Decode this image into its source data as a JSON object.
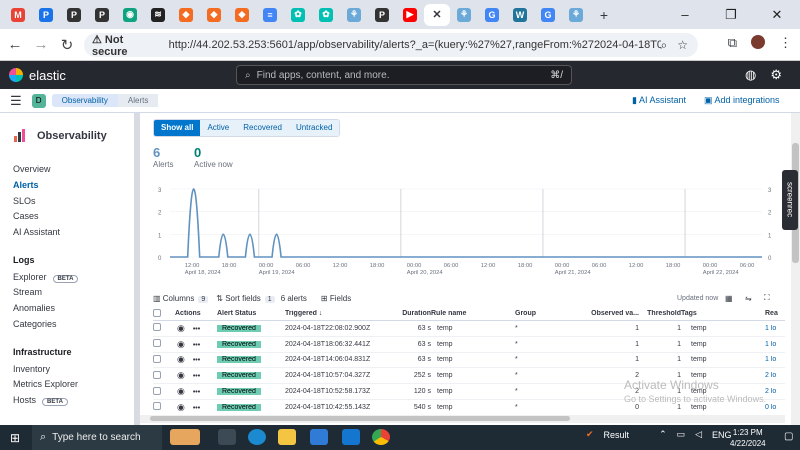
{
  "browser": {
    "window_controls": [
      "–",
      "❐",
      "✕"
    ],
    "back": "←",
    "forward": "→",
    "reload": "↻",
    "security_label": "Not secure",
    "url": "http://44.202.53.253:5601/app/observability/alerts?_a=(kuery:%27%27,rangeFrom:%272024-04-18T07:29:13.770Z...",
    "tabs": [
      {
        "letter": "M",
        "color": "#ea4335"
      },
      {
        "letter": "P",
        "color": "#1a73e8"
      },
      {
        "letter": "P",
        "color": "#333333"
      },
      {
        "letter": "P",
        "color": "#333333"
      },
      {
        "letter": "◉",
        "color": "#10a37f"
      },
      {
        "letter": "≋",
        "color": "#222222"
      },
      {
        "letter": "◆",
        "color": "#f36c21"
      },
      {
        "letter": "◆",
        "color": "#f36c21"
      },
      {
        "letter": "◆",
        "color": "#f36c21"
      },
      {
        "letter": "≡",
        "color": "#4285f4"
      },
      {
        "letter": "✿",
        "color": "#00bfb3"
      },
      {
        "letter": "✿",
        "color": "#00bfb3"
      },
      {
        "letter": "⚘",
        "color": "#6aa9d8"
      },
      {
        "letter": "P",
        "color": "#333333"
      },
      {
        "letter": "▶",
        "color": "#ff0000"
      }
    ],
    "tabs_after": [
      {
        "letter": "⚘",
        "color": "#6aa9d8"
      },
      {
        "letter": "G",
        "color": "#4285f4"
      },
      {
        "letter": "W",
        "color": "#21759b"
      },
      {
        "letter": "G",
        "color": "#4285f4"
      },
      {
        "letter": "⚘",
        "color": "#6aa9d8"
      }
    ],
    "new_tab": "+"
  },
  "elastic": {
    "brand": "elastic",
    "search_placeholder": "Find apps, content, and more.",
    "kbd": "⌘/"
  },
  "breadcrumb": {
    "space": "D",
    "items": [
      "Observability",
      "Alerts"
    ],
    "ai_assistant": "AI Assistant",
    "add_integrations": "Add integrations"
  },
  "sidebar": {
    "title": "Observability",
    "items": [
      "Overview",
      "Alerts",
      "SLOs",
      "Cases",
      "AI Assistant"
    ],
    "logs_title": "Logs",
    "logs": [
      "Explorer",
      "Stream",
      "Anomalies",
      "Categories"
    ],
    "infra_title": "Infrastructure",
    "infra": [
      "Inventory",
      "Metrics Explorer",
      "Hosts"
    ],
    "beta": "BETA"
  },
  "filters": [
    "Show all",
    "Active",
    "Recovered",
    "Untracked"
  ],
  "stats": {
    "alerts_value": "6",
    "alerts_label": "Alerts",
    "active_value": "0",
    "active_label": "Active now"
  },
  "chart_data": {
    "type": "area",
    "y_ticks_left": [
      "3",
      "2",
      "1",
      "0"
    ],
    "y_ticks_right": [
      "3",
      "2",
      "1",
      "0"
    ],
    "x_ticks": [
      {
        "t": "12:00",
        "d": "April 18, 2024"
      },
      {
        "t": "18:00",
        "d": ""
      },
      {
        "t": "00:00",
        "d": "April 19, 2024"
      },
      {
        "t": "06:00",
        "d": ""
      },
      {
        "t": "12:00",
        "d": ""
      },
      {
        "t": "18:00",
        "d": ""
      },
      {
        "t": "00:00",
        "d": "April 20, 2024"
      },
      {
        "t": "06:00",
        "d": ""
      },
      {
        "t": "12:00",
        "d": ""
      },
      {
        "t": "18:00",
        "d": ""
      },
      {
        "t": "00:00",
        "d": "April 21, 2024"
      },
      {
        "t": "06:00",
        "d": ""
      },
      {
        "t": "12:00",
        "d": ""
      },
      {
        "t": "18:00",
        "d": ""
      },
      {
        "t": "00:00",
        "d": "April 22, 2024"
      },
      {
        "t": "06:00",
        "d": ""
      }
    ],
    "ylim": [
      0,
      3
    ],
    "peaks": [
      {
        "x": 0.04,
        "y": 3
      },
      {
        "x": 0.09,
        "y": 1
      },
      {
        "x": 0.135,
        "y": 1
      },
      {
        "x": 0.18,
        "y": 1
      }
    ],
    "color": "#6092c0"
  },
  "toolbar": {
    "columns": "Columns",
    "columns_count": "9",
    "sort": "Sort fields",
    "sort_count": "1",
    "alerts_count": "6 alerts",
    "fields": "Fields",
    "updated": "Updated now"
  },
  "table": {
    "headers": [
      "Actions",
      "Alert Status",
      "Triggered ↓",
      "Duration",
      "Rule name",
      "Group",
      "Observed va...",
      "Threshold",
      "Tags",
      "Rea"
    ],
    "rows": [
      {
        "status": "Recovered",
        "triggered": "2024-04-18T22:08:02.900Z",
        "duration": "63 s",
        "rule": "temp",
        "group": "*",
        "observed": "1",
        "threshold": "1",
        "tags": "temp",
        "reason": "1 lo"
      },
      {
        "status": "Recovered",
        "triggered": "2024-04-18T18:06:32.441Z",
        "duration": "63 s",
        "rule": "temp",
        "group": "*",
        "observed": "1",
        "threshold": "1",
        "tags": "temp",
        "reason": "1 lo"
      },
      {
        "status": "Recovered",
        "triggered": "2024-04-18T14:06:04.831Z",
        "duration": "63 s",
        "rule": "temp",
        "group": "*",
        "observed": "1",
        "threshold": "1",
        "tags": "temp",
        "reason": "1 lo"
      },
      {
        "status": "Recovered",
        "triggered": "2024-04-18T10:57:04.327Z",
        "duration": "252 s",
        "rule": "temp",
        "group": "*",
        "observed": "2",
        "threshold": "1",
        "tags": "temp",
        "reason": "2 lo"
      },
      {
        "status": "Recovered",
        "triggered": "2024-04-18T10:52:58.173Z",
        "duration": "120 s",
        "rule": "temp",
        "group": "*",
        "observed": "2",
        "threshold": "1",
        "tags": "temp",
        "reason": "2 lo"
      },
      {
        "status": "Recovered",
        "triggered": "2024-04-18T10:42:55.143Z",
        "duration": "540 s",
        "rule": "temp",
        "group": "*",
        "observed": "0",
        "threshold": "1",
        "tags": "temp",
        "reason": "0 lo"
      }
    ]
  },
  "overlay": {
    "activate": "Activate Windows",
    "activate_sub": "Go to Settings to activate Windows.",
    "screenrec": "screenrec"
  },
  "taskbar": {
    "search": "Type here to search",
    "result": "Result",
    "lang": "ENG",
    "time": "1:23 PM",
    "date": "4/22/2024"
  }
}
